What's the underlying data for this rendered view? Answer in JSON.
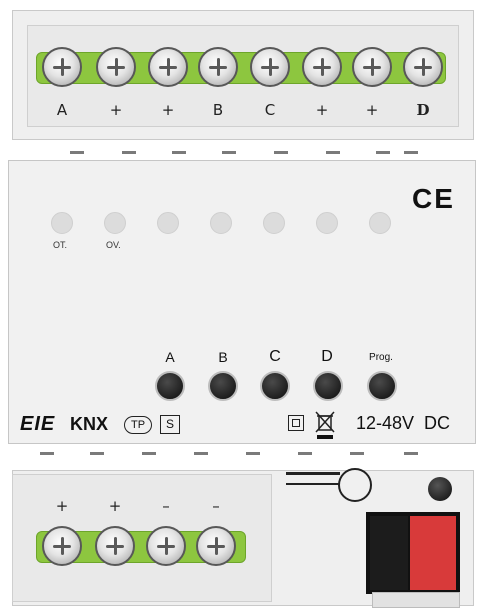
{
  "top_terminals": {
    "labels": [
      "A",
      "+",
      "+",
      "B",
      "C",
      "+",
      "+",
      "D"
    ]
  },
  "leds": {
    "labels": [
      "OT.",
      "OV."
    ]
  },
  "buttons": {
    "labels": [
      "A",
      "B",
      "C",
      "D",
      "Prog."
    ]
  },
  "markings": {
    "ce": "CE",
    "brand": "EIE",
    "knx": "KNX",
    "tp": "TP",
    "s": "S",
    "voltage": "12-48V  DC"
  },
  "bottom_terminals": {
    "labels": [
      "+",
      "+",
      "–",
      "–"
    ]
  },
  "colors": {
    "terminal_green": "#8dc63f",
    "bus_red": "#d83a3a"
  }
}
